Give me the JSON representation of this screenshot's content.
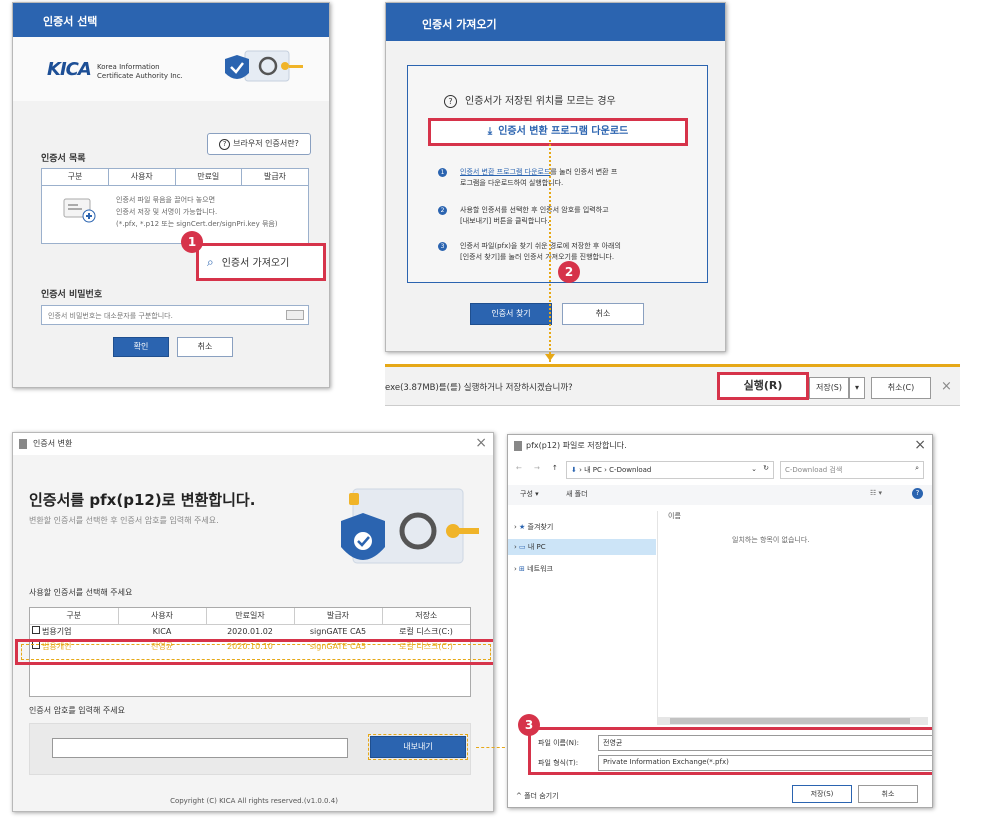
{
  "p1": {
    "title": "인증서 선택",
    "logo": "KICA",
    "logo_sub1": "Korea Information",
    "logo_sub2": "Certificate Authority Inc.",
    "browser_cert_btn": "브라우저 인증서란?",
    "list_label": "인증서 목록",
    "cols": [
      "구분",
      "사용자",
      "만료일",
      "발급자"
    ],
    "hint1": "인증서 파일 묶음을 끌어다 놓으면",
    "hint2": "인증서 저장 및 서명이 가능합니다.",
    "hint3": "(*.pfx, *.p12 또는 signCert.der/signPri.key 묶음)",
    "import_btn": "인증서 가져오기",
    "pw_label": "인증서 비밀번호",
    "pw_placeholder": "인증서 비밀번호는 대소문자를 구분합니다.",
    "ok": "확인",
    "cancel": "취소"
  },
  "p2": {
    "title": "인증서 가져오기",
    "question": "인증서가 저장된 위치를 모르는 경우",
    "download_btn": "인증서 변환 프로그램 다운로드",
    "step1_link": "인증서 변환 프로그램 다운로드",
    "step1_rest": "를 눌러 인증서 변환 프",
    "step1_line2": "로그램을 다운로드하여 실행합니다.",
    "step2_line1": "사용할 인증서를 선택한 후 인증서 암호를 입력하고",
    "step2_line2": "[내보내기] 버튼을 클릭합니다.",
    "step3_line1": "인증서 파일(pfx)을 찾기 쉬운 경로에 저장한 후 아래의",
    "step3_line2": "[인증서 찾기]를 눌러 인증서 가져오기를 진행합니다.",
    "find_btn": "인증서 찾기",
    "cancel_btn": "취소"
  },
  "dlbar": {
    "text": "exe(3.87MB)를(를) 실행하거나 저장하시겠습니까?",
    "run": "실행(R)",
    "save": "저장(S)",
    "cancel": "취소(C)",
    "close": "×"
  },
  "p3": {
    "title": "인증서 변환",
    "heading": "인증서를 pfx(p12)로 변환합니다.",
    "subheading": "변환할 인증서를 선택한 후 인증서 암호를 입력해 주세요.",
    "select_label": "사용할 인증서를 선택해 주세요",
    "cols": [
      "구분",
      "사용자",
      "만료일자",
      "발급자",
      "저장소"
    ],
    "rows": [
      [
        "범용기업",
        "KICA",
        "2020.01.02",
        "signGATE CA5",
        "로컬 디스크(C:)"
      ],
      [
        "범용개인",
        "전영균",
        "2020.10.10",
        "signGATE CA5",
        "로컬 디스크(C:)"
      ]
    ],
    "pw_label": "인증서 암호를 입력해 주세요",
    "export_btn": "내보내기",
    "footer": "Copyright (C) KICA All rights reserved.(v1.0.0.4)",
    "close": "×"
  },
  "p4": {
    "title": "pfx(p12) 파일로 저장합니다.",
    "path_pc": "내 PC",
    "path_folder": "C-Download",
    "search_placeholder": "C-Download 검색",
    "organize": "구성 ▾",
    "new_folder": "새 폴더",
    "col_name": "이름",
    "empty": "일치하는 항목이 없습니다.",
    "tree": [
      "즐겨찾기",
      "내 PC",
      "네트워크"
    ],
    "filename_label": "파일 이름(N):",
    "filename_value": "전영균",
    "filetype_label": "파일 형식(T):",
    "filetype_value": "Private Information Exchange(*.pfx)",
    "hide_folders": "폴더 숨기기",
    "save_btn": "저장(S)",
    "cancel_btn": "취소",
    "close": "×"
  },
  "badges": [
    "1",
    "2",
    "3"
  ],
  "colors": {
    "accent": "#2b64b0",
    "highlight": "#d6334a",
    "orange": "#e6a817"
  }
}
